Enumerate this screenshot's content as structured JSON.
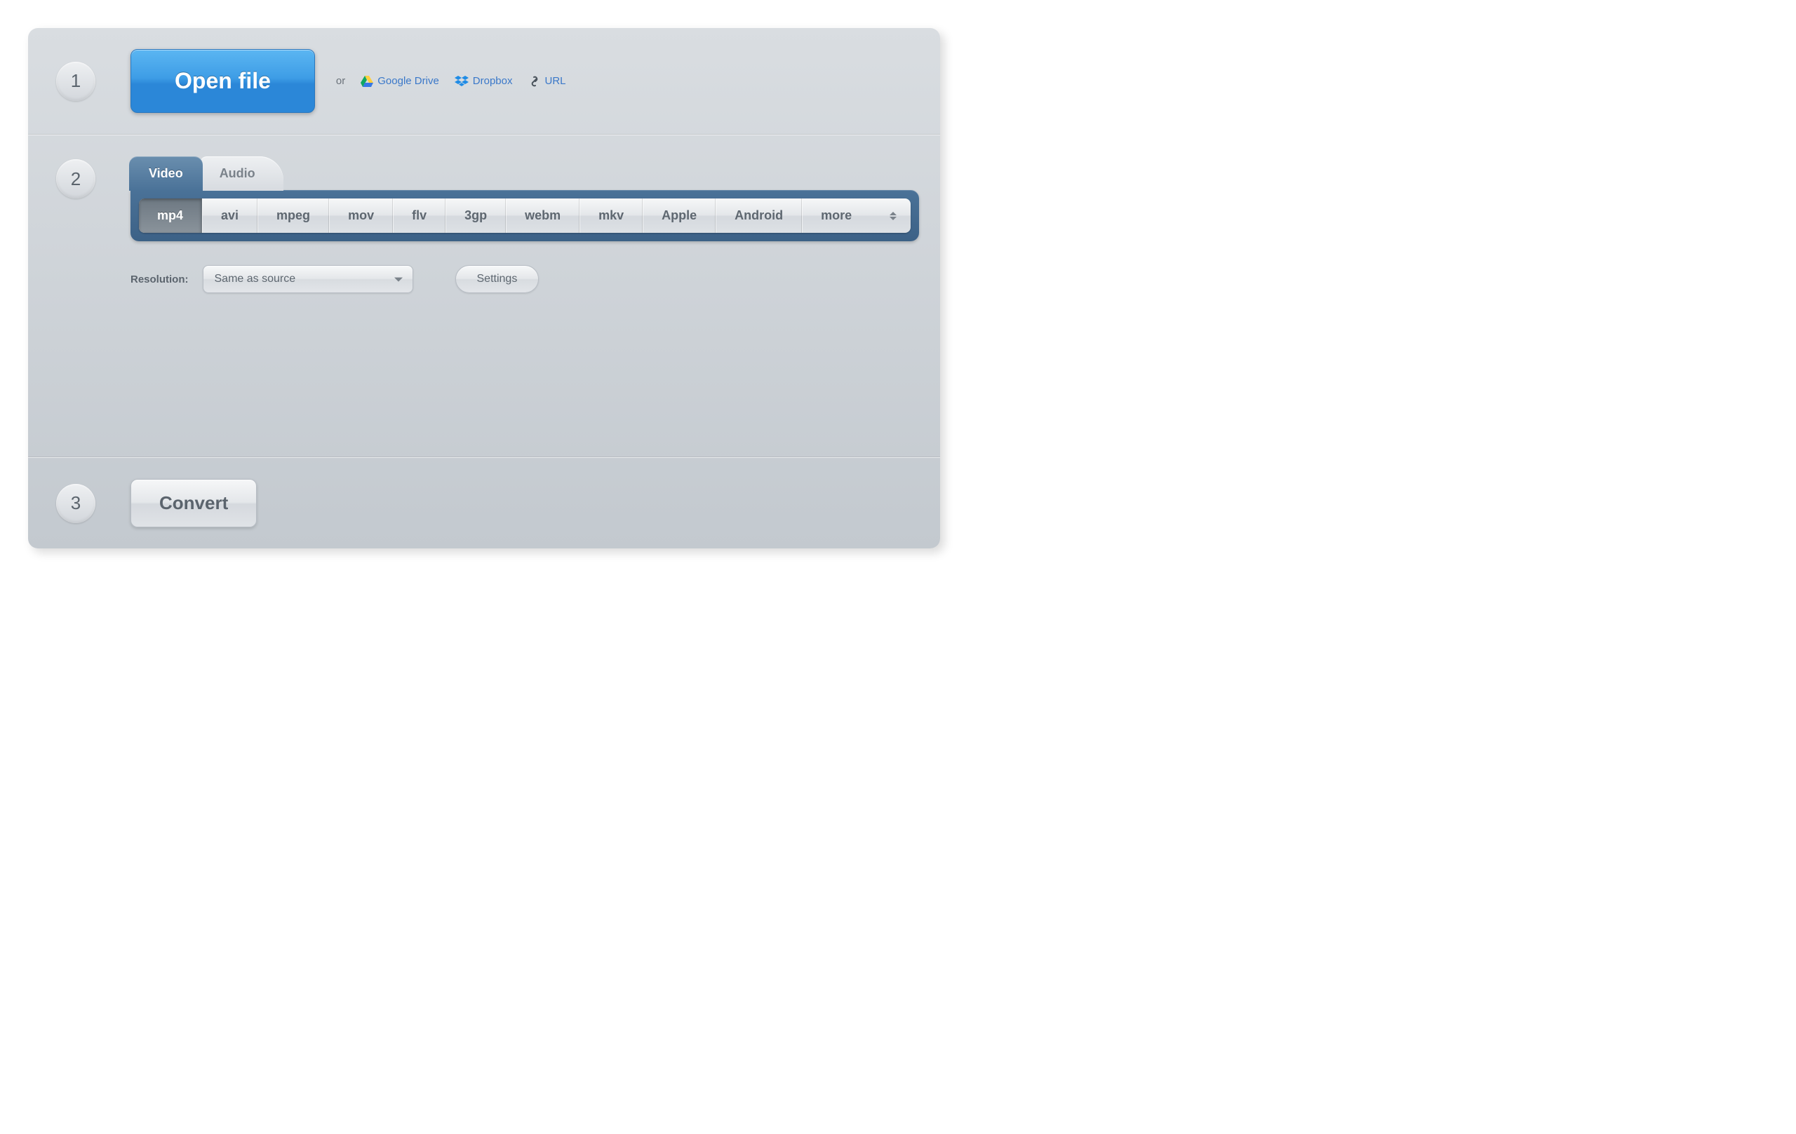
{
  "steps": {
    "one": "1",
    "two": "2",
    "three": "3"
  },
  "open": {
    "button": "Open file",
    "or": "or",
    "sources": {
      "gdrive": "Google Drive",
      "dropbox": "Dropbox",
      "url": "URL"
    }
  },
  "tabs": {
    "video": "Video",
    "audio": "Audio",
    "active": "video"
  },
  "formats": {
    "items": [
      "mp4",
      "avi",
      "mpeg",
      "mov",
      "flv",
      "3gp",
      "webm",
      "mkv",
      "Apple",
      "Android"
    ],
    "more": "more",
    "active": "mp4"
  },
  "resolution": {
    "label": "Resolution:",
    "value": "Same as source"
  },
  "settings_button": "Settings",
  "convert_button": "Convert"
}
